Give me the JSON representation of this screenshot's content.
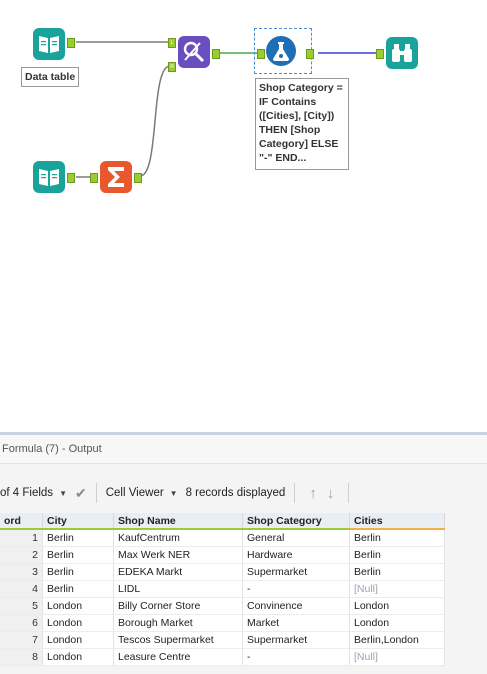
{
  "canvas": {
    "input1_label": "Data table",
    "formula_annotation": "Shop Category =\nIF Contains\n([Cities], [City])\nTHEN [Shop\nCategory] ELSE\n\"-\" END...",
    "join_port_left": "L",
    "join_port_right": "R",
    "colors": {
      "input_tool": "#1aa39a",
      "join_tool": "#6a4ec0",
      "summarize_tool": "#e8582c",
      "formula_tool": "#1f6fb5",
      "browse_tool": "#1aa39a",
      "wire": "#7a7a7a",
      "wire_selected": "#3b3ed8"
    }
  },
  "results": {
    "title": "Formula (7) - Output",
    "fields_label": "of 4 Fields",
    "cell_viewer_label": "Cell Viewer",
    "records_label": "8 records displayed",
    "columns": [
      "ord",
      "City",
      "Shop Name",
      "Shop Category",
      "Cities"
    ],
    "rows": [
      [
        "1",
        "Berlin",
        "KaufCentrum",
        "General",
        "Berlin"
      ],
      [
        "2",
        "Berlin",
        "Max Werk NER",
        "Hardware",
        "Berlin"
      ],
      [
        "3",
        "Berlin",
        "EDEKA Markt",
        "Supermarket",
        "Berlin"
      ],
      [
        "4",
        "Berlin",
        "LIDL",
        "-",
        "[Null]"
      ],
      [
        "5",
        "London",
        "Billy Corner Store",
        "Convinence",
        "London"
      ],
      [
        "6",
        "London",
        "Borough Market",
        "Market",
        "London"
      ],
      [
        "7",
        "London",
        "Tescos Supermarket",
        "Supermarket",
        "Berlin,London"
      ],
      [
        "8",
        "London",
        "Leasure Centre",
        "-",
        "[Null]"
      ]
    ]
  }
}
